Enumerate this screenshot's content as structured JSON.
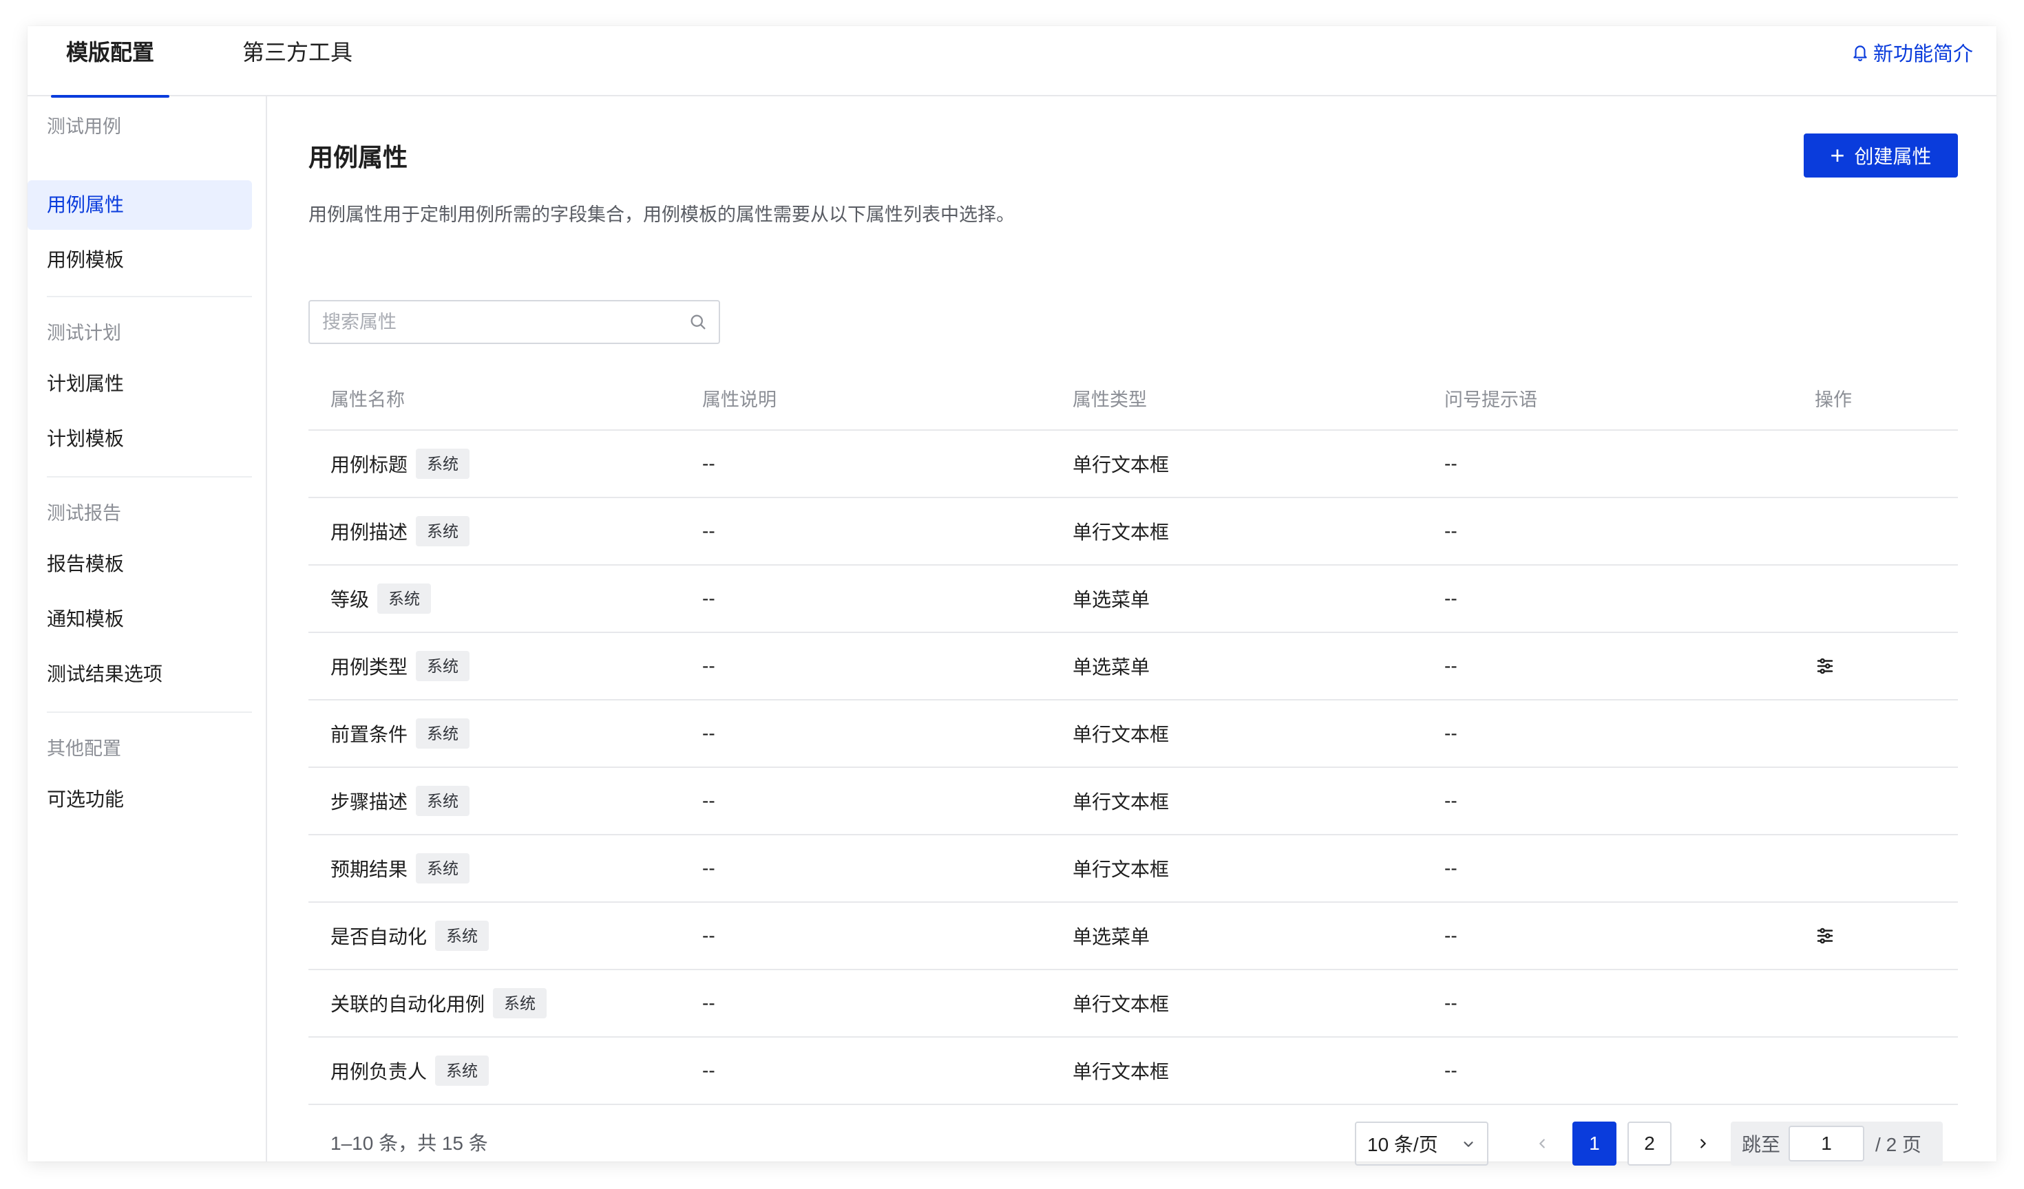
{
  "top_tabs": [
    {
      "label": "模版配置"
    },
    {
      "label": "第三方工具"
    }
  ],
  "top_link": {
    "label": "新功能简介",
    "icon": "bell-icon"
  },
  "sidebar": {
    "groups": [
      {
        "title": "测试用例",
        "items": [
          {
            "label": "用例属性"
          },
          {
            "label": "用例模板"
          }
        ]
      },
      {
        "title": "测试计划",
        "items": [
          {
            "label": "计划属性"
          },
          {
            "label": "计划模板"
          }
        ]
      },
      {
        "title": "测试报告",
        "items": [
          {
            "label": "报告模板"
          },
          {
            "label": "通知模板"
          },
          {
            "label": "测试结果选项"
          }
        ]
      },
      {
        "title": "其他配置",
        "items": [
          {
            "label": "可选功能"
          }
        ]
      }
    ],
    "active": "用例属性"
  },
  "main": {
    "title": "用例属性",
    "create_button": "创建属性",
    "description": "用例属性用于定制用例所需的字段集合，用例模板的属性需要从以下属性列表中选择。",
    "search_placeholder": "搜索属性"
  },
  "table": {
    "columns": [
      "属性名称",
      "属性说明",
      "属性类型",
      "问号提示语",
      "操作"
    ],
    "rows": [
      {
        "name": "用例标题",
        "badge": "系统",
        "desc": "--",
        "type": "单行文本框",
        "tip": "--",
        "op": ""
      },
      {
        "name": "用例描述",
        "badge": "系统",
        "desc": "--",
        "type": "单行文本框",
        "tip": "--",
        "op": ""
      },
      {
        "name": "等级",
        "badge": "系统",
        "desc": "--",
        "type": "单选菜单",
        "tip": "--",
        "op": ""
      },
      {
        "name": "用例类型",
        "badge": "系统",
        "desc": "--",
        "type": "单选菜单",
        "tip": "--",
        "op": "sliders-icon"
      },
      {
        "name": "前置条件",
        "badge": "系统",
        "desc": "--",
        "type": "单行文本框",
        "tip": "--",
        "op": ""
      },
      {
        "name": "步骤描述",
        "badge": "系统",
        "desc": "--",
        "type": "单行文本框",
        "tip": "--",
        "op": ""
      },
      {
        "name": "预期结果",
        "badge": "系统",
        "desc": "--",
        "type": "单行文本框",
        "tip": "--",
        "op": ""
      },
      {
        "name": "是否自动化",
        "badge": "系统",
        "desc": "--",
        "type": "单选菜单",
        "tip": "--",
        "op": "sliders-icon"
      },
      {
        "name": "关联的自动化用例",
        "badge": "系统",
        "desc": "--",
        "type": "单行文本框",
        "tip": "--",
        "op": ""
      },
      {
        "name": "用例负责人",
        "badge": "系统",
        "desc": "--",
        "type": "单行文本框",
        "tip": "--",
        "op": ""
      }
    ]
  },
  "pagination": {
    "total_text": "1–10 条，共 15 条",
    "page_size": "10 条/页",
    "pages": [
      "1",
      "2"
    ],
    "current_page": "1",
    "jump_label": "跳至",
    "jump_value": "1",
    "total_pages_text": "/ 2 页"
  },
  "colors": {
    "accent": "#0a3cdc",
    "active_bg": "#eaf0ff",
    "badge_bg": "#eeeff1",
    "border": "#e7e8eb"
  }
}
